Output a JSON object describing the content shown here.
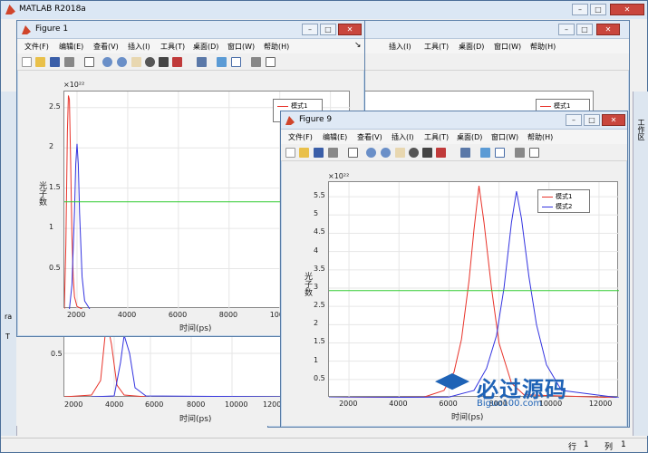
{
  "main": {
    "title": "MATLAB R2018a",
    "status": {
      "row_label": "行",
      "row_value": "1",
      "col_label": "列",
      "col_value": "1"
    },
    "right_tab": "工作区",
    "left_tab_text": "ra",
    "left_tab_text2": "T"
  },
  "fig1": {
    "title": "Figure 1",
    "menu": [
      "文件(F)",
      "编辑(E)",
      "查看(V)",
      "插入(I)",
      "工具(T)",
      "桌面(D)",
      "窗口(W)",
      "帮助(H)"
    ],
    "exponent": "×10²²",
    "ylabel": "光子数",
    "xlabel": "时间(ps)",
    "yticks": [
      "0.5",
      "1",
      "1.5",
      "2",
      "2.5"
    ],
    "xticks": [
      "2000",
      "4000",
      "6000",
      "8000",
      "10000",
      "120"
    ],
    "legend": [
      "模式1"
    ]
  },
  "back": {
    "yticks": [
      "0.5"
    ],
    "xticks": [
      "2000",
      "4000",
      "6000",
      "8000",
      "10000",
      "12000"
    ],
    "xlabel": "时间(ps)",
    "legend": [
      "模式1"
    ],
    "menu": [
      "插入(I)",
      "工具(T)",
      "桌面(D)",
      "窗口(W)",
      "帮助(H)"
    ]
  },
  "fig9": {
    "title": "Figure 9",
    "menu": [
      "文件(F)",
      "编辑(E)",
      "查看(V)",
      "插入(I)",
      "工具(T)",
      "桌面(D)",
      "窗口(W)",
      "帮助(H)"
    ],
    "exponent": "×10²²",
    "ylabel": "光子数",
    "xlabel": "时间(ps)",
    "yticks": [
      "0.5",
      "1",
      "1.5",
      "2",
      "2.5",
      "3",
      "3.5",
      "4",
      "4.5",
      "5",
      "5.5"
    ],
    "xticks": [
      "2000",
      "4000",
      "6000",
      "8000",
      "10000",
      "12000"
    ],
    "legend": [
      "模式1",
      "模式2"
    ]
  },
  "watermark": {
    "main": "必过源码",
    "sub": "Biguo100.com"
  },
  "chart_data": [
    {
      "type": "line",
      "xlabel": "时间(ps)",
      "ylabel": "光子数",
      "xlim": [
        1500,
        12800
      ],
      "ylim": [
        0,
        2.7
      ],
      "series": [
        {
          "name": "模式1",
          "color": "#e8332a",
          "x": [
            1500,
            1560,
            1620,
            1660,
            1700,
            1750,
            1800,
            1850,
            1900,
            2000,
            2200
          ],
          "values": [
            0,
            0.8,
            2.2,
            2.65,
            2.6,
            1.8,
            0.9,
            0.4,
            0.15,
            0.03,
            0
          ]
        },
        {
          "color": "#3333e0",
          "x": [
            1700,
            1800,
            1900,
            1950,
            2000,
            2050,
            2100,
            2200,
            2300,
            2500
          ],
          "values": [
            0,
            0.3,
            1.2,
            1.8,
            2.05,
            1.8,
            1.2,
            0.4,
            0.1,
            0
          ]
        },
        {
          "color": "#33cc33",
          "x": [
            1500,
            12800
          ],
          "values": [
            1.33,
            1.33
          ]
        }
      ]
    },
    {
      "type": "line",
      "xlabel": "时间(ps)",
      "ylabel": "光子数",
      "xlim": [
        1200,
        12800
      ],
      "ylim": [
        0,
        5.9
      ],
      "series": [
        {
          "name": "模式1",
          "color": "#e8332a",
          "x": [
            1200,
            5000,
            5800,
            6200,
            6500,
            6800,
            7000,
            7200,
            7400,
            7700,
            8000,
            8500,
            9000,
            12800
          ],
          "values": [
            0,
            0.02,
            0.2,
            0.7,
            1.6,
            3.2,
            4.6,
            5.8,
            4.8,
            3.0,
            1.5,
            0.4,
            0.08,
            0
          ]
        },
        {
          "name": "模式2",
          "color": "#3333e0",
          "x": [
            1200,
            6000,
            7000,
            7500,
            7900,
            8200,
            8500,
            8700,
            8900,
            9200,
            9500,
            9900,
            10500,
            12800
          ],
          "values": [
            0,
            0.02,
            0.2,
            0.8,
            1.7,
            3.0,
            4.8,
            5.65,
            4.9,
            3.3,
            2.0,
            0.9,
            0.2,
            0
          ]
        },
        {
          "color": "#33cc33",
          "x": [
            1200,
            12800
          ],
          "values": [
            2.93,
            2.93
          ]
        }
      ]
    }
  ]
}
